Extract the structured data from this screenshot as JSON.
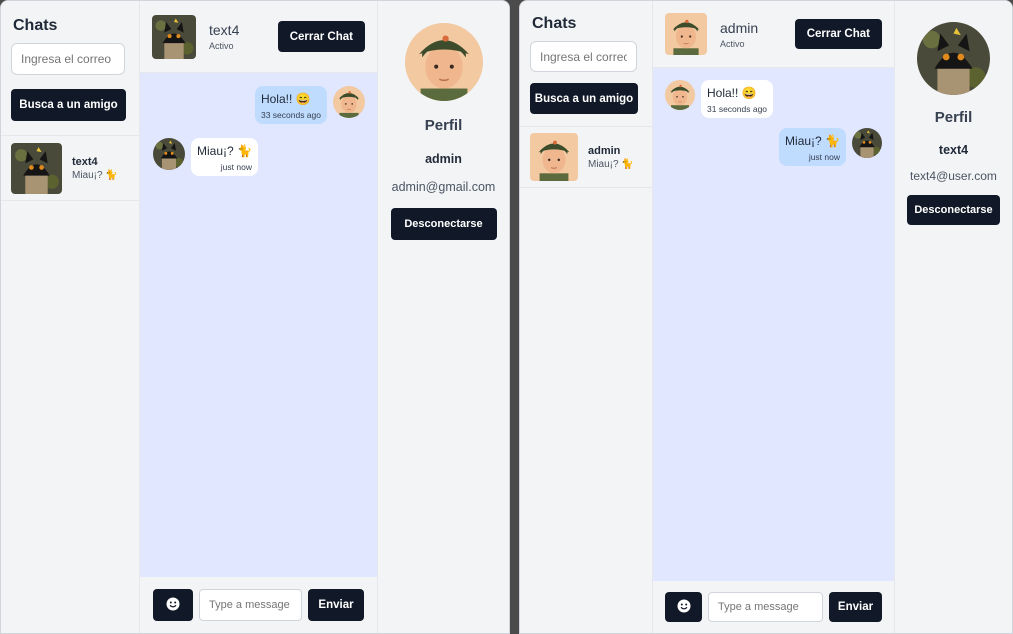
{
  "window_a": {
    "sidebar": {
      "title": "Chats",
      "search_placeholder": "Ingresa el correo",
      "find_button": "Busca a un amigo",
      "contacts": [
        {
          "name": "text4",
          "last_message": "Miau¡? 🐈",
          "avatar": "cat-avatar"
        }
      ]
    },
    "chat": {
      "contact_name": "text4",
      "contact_status": "Activo",
      "close_button": "Cerrar Chat",
      "messages": [
        {
          "side": "sent",
          "text": "Hola!! 😄",
          "time": "33 seconds ago",
          "avatar": "boy-avatar"
        },
        {
          "side": "received",
          "text": "Miau¡? 🐈",
          "time": "just now",
          "avatar": "cat-avatar"
        }
      ],
      "input_placeholder": "Type a message",
      "send_button": "Enviar",
      "emoji_icon": "smiley-icon"
    },
    "profile": {
      "title": "Perfil",
      "name": "admin",
      "email": "admin@gmail.com",
      "logout_button": "Desconectarse",
      "avatar": "boy-avatar"
    }
  },
  "window_b": {
    "sidebar": {
      "title": "Chats",
      "search_placeholder": "Ingresa el correo",
      "find_button": "Busca a un amigo",
      "contacts": [
        {
          "name": "admin",
          "last_message": "Miau¡? 🐈",
          "avatar": "boy-avatar"
        }
      ]
    },
    "chat": {
      "contact_name": "admin",
      "contact_status": "Activo",
      "close_button": "Cerrar Chat",
      "messages": [
        {
          "side": "received",
          "text": "Hola!! 😄",
          "time": "31 seconds ago",
          "avatar": "boy-avatar"
        },
        {
          "side": "sent",
          "text": "Miau¡? 🐈",
          "time": "just now",
          "avatar": "cat-avatar"
        }
      ],
      "input_placeholder": "Type a message",
      "send_button": "Enviar",
      "emoji_icon": "smiley-icon"
    },
    "profile": {
      "title": "Perfil",
      "name": "text4",
      "email": "text4@user.com",
      "logout_button": "Desconectarse",
      "avatar": "cat-avatar"
    }
  },
  "colors": {
    "primary_button": "#111827",
    "chat_background": "#e0e7ff",
    "sent_bubble": "#bfdbfe",
    "received_bubble": "#ffffff",
    "panel_background": "#f3f4f6"
  }
}
